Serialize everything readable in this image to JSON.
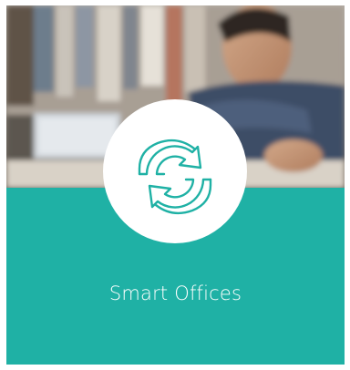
{
  "tile": {
    "title": "Smart Offices",
    "icon": "sync-icon",
    "accent_color": "#1fb1a5"
  }
}
